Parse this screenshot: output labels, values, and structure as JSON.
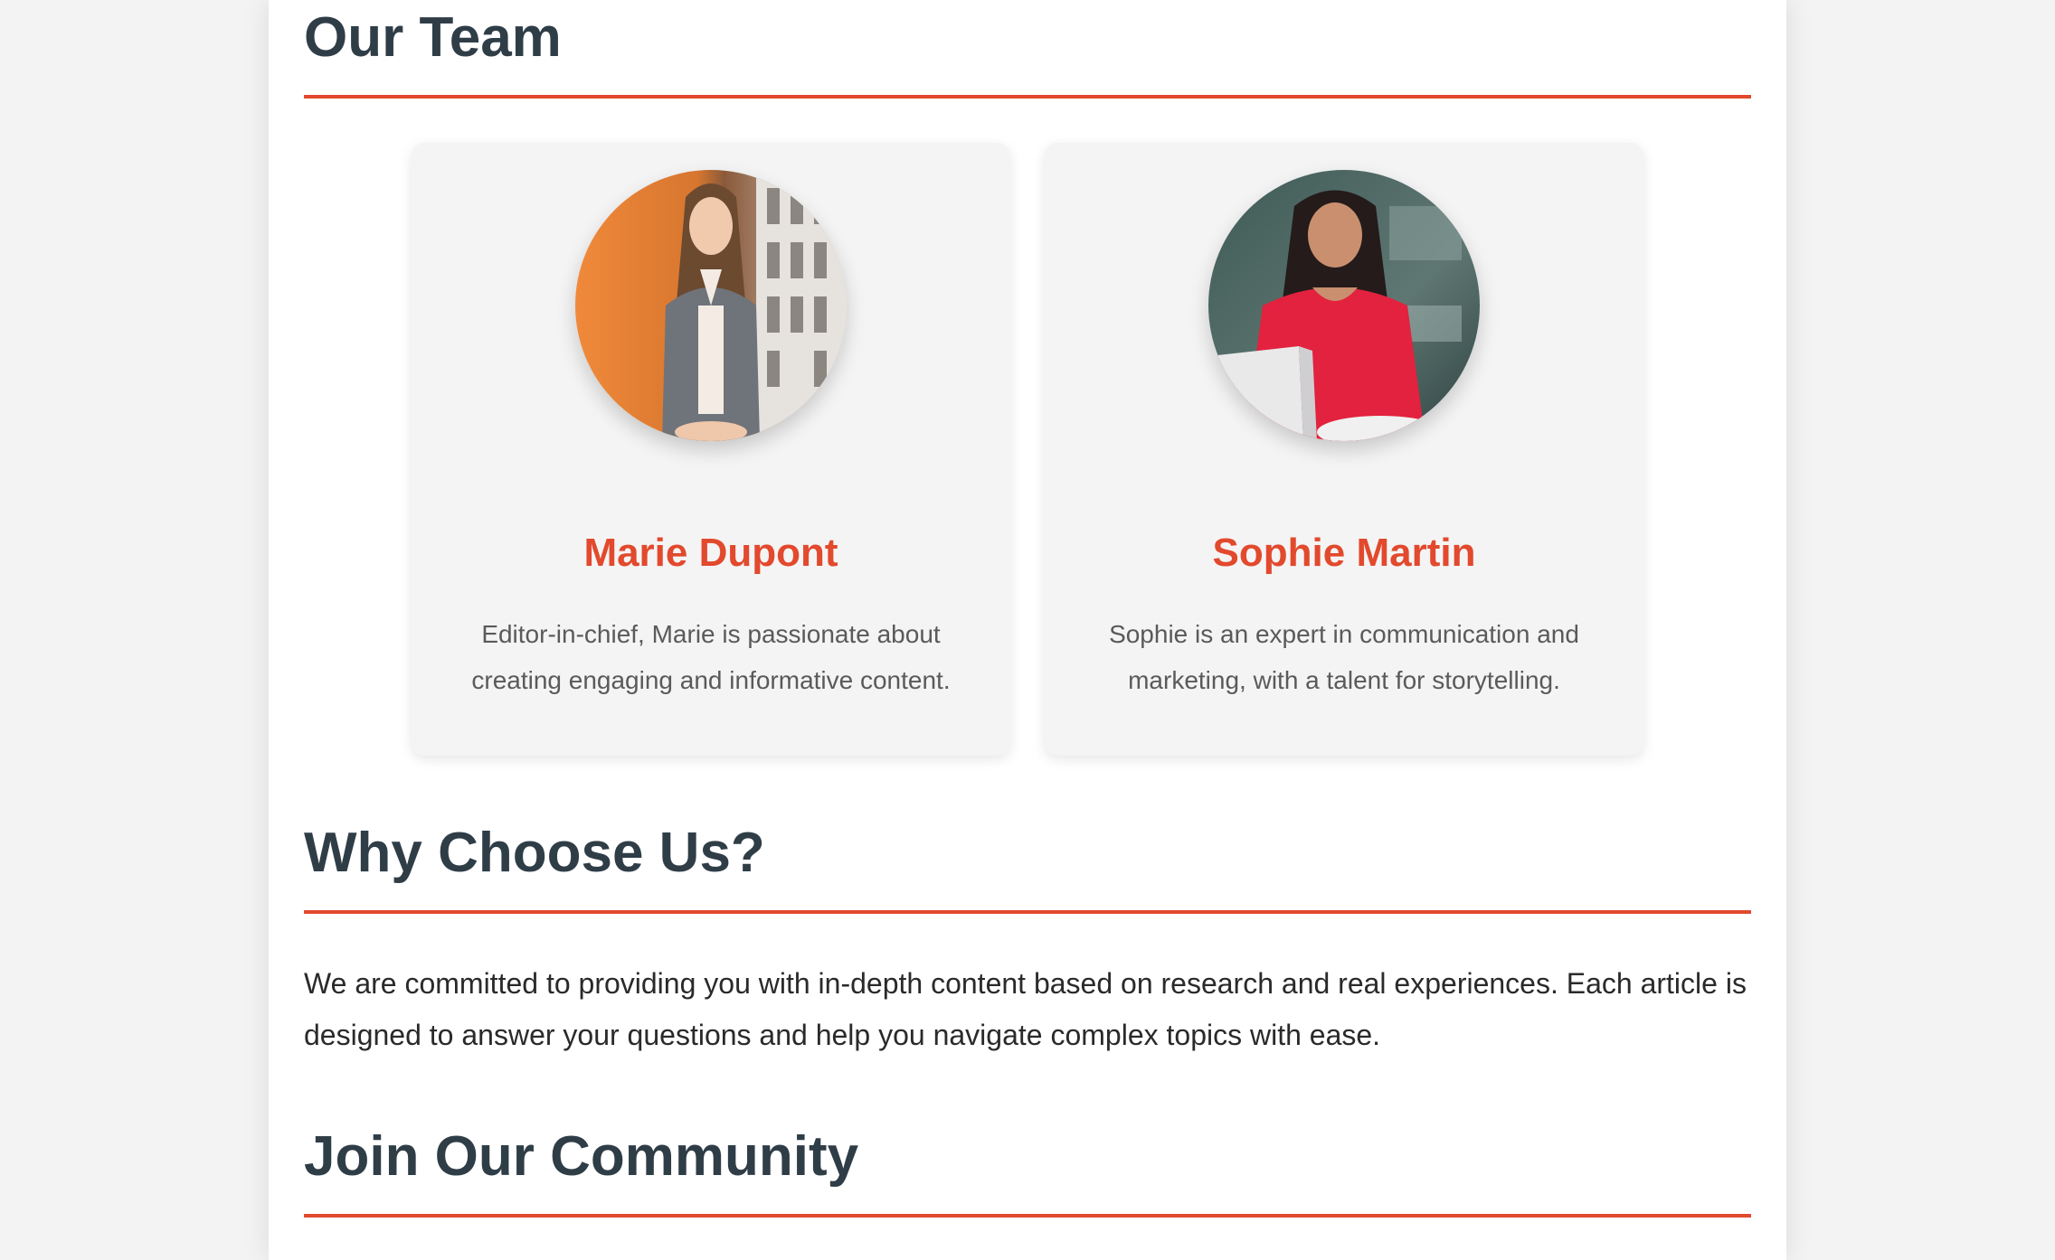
{
  "team_section": {
    "title": "Our Team",
    "members": [
      {
        "name": "Marie Dupont",
        "bio": "Editor-in-chief, Marie is passionate about creating engaging and informative content.",
        "photo_icon": "portrait-woman-grey-blazer-photo"
      },
      {
        "name": "Sophie Martin",
        "bio": "Sophie is an expert in communication and marketing, with a talent for storytelling.",
        "photo_icon": "portrait-woman-red-top-laptop-photo"
      }
    ]
  },
  "why_section": {
    "title": "Why Choose Us?",
    "text": "We are committed to providing you with in-depth content based on research and real experiences. Each article is designed to answer your questions and help you navigate complex topics with ease."
  },
  "community_section": {
    "title": "Join Our Community"
  },
  "colors": {
    "accent": "#e2492d",
    "heading": "#2f3d47",
    "card_background": "#f4f4f4",
    "page_background": "#f3f3f3"
  }
}
